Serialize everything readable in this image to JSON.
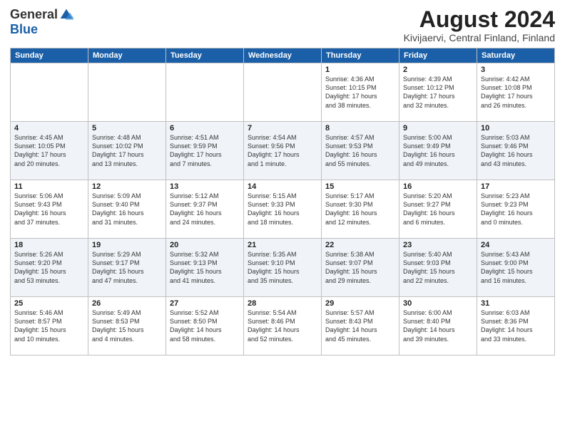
{
  "header": {
    "logo_general": "General",
    "logo_blue": "Blue",
    "month_title": "August 2024",
    "location": "Kivijaervi, Central Finland, Finland"
  },
  "columns": [
    "Sunday",
    "Monday",
    "Tuesday",
    "Wednesday",
    "Thursday",
    "Friday",
    "Saturday"
  ],
  "weeks": [
    [
      {
        "day": "",
        "info": ""
      },
      {
        "day": "",
        "info": ""
      },
      {
        "day": "",
        "info": ""
      },
      {
        "day": "",
        "info": ""
      },
      {
        "day": "1",
        "info": "Sunrise: 4:36 AM\nSunset: 10:15 PM\nDaylight: 17 hours\nand 38 minutes."
      },
      {
        "day": "2",
        "info": "Sunrise: 4:39 AM\nSunset: 10:12 PM\nDaylight: 17 hours\nand 32 minutes."
      },
      {
        "day": "3",
        "info": "Sunrise: 4:42 AM\nSunset: 10:08 PM\nDaylight: 17 hours\nand 26 minutes."
      }
    ],
    [
      {
        "day": "4",
        "info": "Sunrise: 4:45 AM\nSunset: 10:05 PM\nDaylight: 17 hours\nand 20 minutes."
      },
      {
        "day": "5",
        "info": "Sunrise: 4:48 AM\nSunset: 10:02 PM\nDaylight: 17 hours\nand 13 minutes."
      },
      {
        "day": "6",
        "info": "Sunrise: 4:51 AM\nSunset: 9:59 PM\nDaylight: 17 hours\nand 7 minutes."
      },
      {
        "day": "7",
        "info": "Sunrise: 4:54 AM\nSunset: 9:56 PM\nDaylight: 17 hours\nand 1 minute."
      },
      {
        "day": "8",
        "info": "Sunrise: 4:57 AM\nSunset: 9:53 PM\nDaylight: 16 hours\nand 55 minutes."
      },
      {
        "day": "9",
        "info": "Sunrise: 5:00 AM\nSunset: 9:49 PM\nDaylight: 16 hours\nand 49 minutes."
      },
      {
        "day": "10",
        "info": "Sunrise: 5:03 AM\nSunset: 9:46 PM\nDaylight: 16 hours\nand 43 minutes."
      }
    ],
    [
      {
        "day": "11",
        "info": "Sunrise: 5:06 AM\nSunset: 9:43 PM\nDaylight: 16 hours\nand 37 minutes."
      },
      {
        "day": "12",
        "info": "Sunrise: 5:09 AM\nSunset: 9:40 PM\nDaylight: 16 hours\nand 31 minutes."
      },
      {
        "day": "13",
        "info": "Sunrise: 5:12 AM\nSunset: 9:37 PM\nDaylight: 16 hours\nand 24 minutes."
      },
      {
        "day": "14",
        "info": "Sunrise: 5:15 AM\nSunset: 9:33 PM\nDaylight: 16 hours\nand 18 minutes."
      },
      {
        "day": "15",
        "info": "Sunrise: 5:17 AM\nSunset: 9:30 PM\nDaylight: 16 hours\nand 12 minutes."
      },
      {
        "day": "16",
        "info": "Sunrise: 5:20 AM\nSunset: 9:27 PM\nDaylight: 16 hours\nand 6 minutes."
      },
      {
        "day": "17",
        "info": "Sunrise: 5:23 AM\nSunset: 9:23 PM\nDaylight: 16 hours\nand 0 minutes."
      }
    ],
    [
      {
        "day": "18",
        "info": "Sunrise: 5:26 AM\nSunset: 9:20 PM\nDaylight: 15 hours\nand 53 minutes."
      },
      {
        "day": "19",
        "info": "Sunrise: 5:29 AM\nSunset: 9:17 PM\nDaylight: 15 hours\nand 47 minutes."
      },
      {
        "day": "20",
        "info": "Sunrise: 5:32 AM\nSunset: 9:13 PM\nDaylight: 15 hours\nand 41 minutes."
      },
      {
        "day": "21",
        "info": "Sunrise: 5:35 AM\nSunset: 9:10 PM\nDaylight: 15 hours\nand 35 minutes."
      },
      {
        "day": "22",
        "info": "Sunrise: 5:38 AM\nSunset: 9:07 PM\nDaylight: 15 hours\nand 29 minutes."
      },
      {
        "day": "23",
        "info": "Sunrise: 5:40 AM\nSunset: 9:03 PM\nDaylight: 15 hours\nand 22 minutes."
      },
      {
        "day": "24",
        "info": "Sunrise: 5:43 AM\nSunset: 9:00 PM\nDaylight: 15 hours\nand 16 minutes."
      }
    ],
    [
      {
        "day": "25",
        "info": "Sunrise: 5:46 AM\nSunset: 8:57 PM\nDaylight: 15 hours\nand 10 minutes."
      },
      {
        "day": "26",
        "info": "Sunrise: 5:49 AM\nSunset: 8:53 PM\nDaylight: 15 hours\nand 4 minutes."
      },
      {
        "day": "27",
        "info": "Sunrise: 5:52 AM\nSunset: 8:50 PM\nDaylight: 14 hours\nand 58 minutes."
      },
      {
        "day": "28",
        "info": "Sunrise: 5:54 AM\nSunset: 8:46 PM\nDaylight: 14 hours\nand 52 minutes."
      },
      {
        "day": "29",
        "info": "Sunrise: 5:57 AM\nSunset: 8:43 PM\nDaylight: 14 hours\nand 45 minutes."
      },
      {
        "day": "30",
        "info": "Sunrise: 6:00 AM\nSunset: 8:40 PM\nDaylight: 14 hours\nand 39 minutes."
      },
      {
        "day": "31",
        "info": "Sunrise: 6:03 AM\nSunset: 8:36 PM\nDaylight: 14 hours\nand 33 minutes."
      }
    ]
  ]
}
